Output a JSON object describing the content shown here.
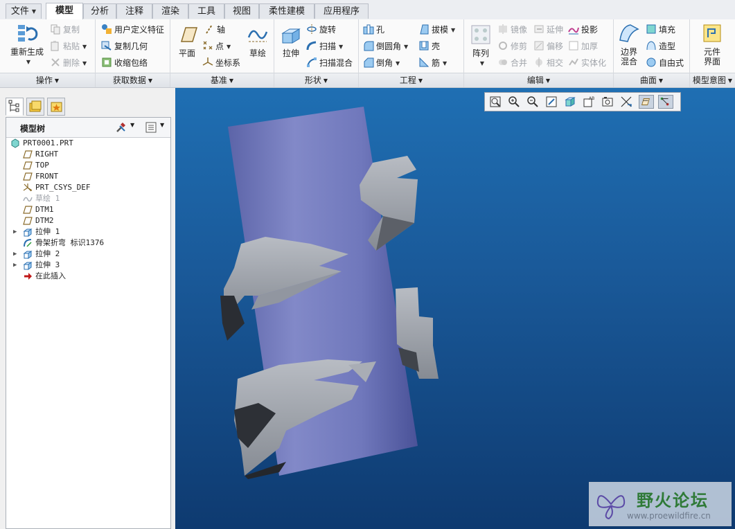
{
  "tabs": [
    {
      "label": "文件",
      "has_dropdown": true
    },
    {
      "label": "模型",
      "active": true
    },
    {
      "label": "分析"
    },
    {
      "label": "注释"
    },
    {
      "label": "渲染"
    },
    {
      "label": "工具"
    },
    {
      "label": "视图"
    },
    {
      "label": "柔性建模"
    },
    {
      "label": "应用程序"
    }
  ],
  "ribbon": {
    "operations": {
      "label": "操作",
      "regenerate": "重新生成",
      "copy": "复制",
      "paste": "粘贴",
      "delete": "删除"
    },
    "get_data": {
      "label": "获取数据",
      "udf": "用户定义特征",
      "copy_geometry": "复制几何",
      "shrinkwrap": "收缩包络"
    },
    "datum": {
      "label": "基准",
      "plane": "平面",
      "axis": "轴",
      "point": "点",
      "csys": "坐标系",
      "sketch": "草绘"
    },
    "shapes": {
      "label": "形状",
      "extrude": "拉伸",
      "revolve": "旋转",
      "sweep": "扫描",
      "swept_blend": "扫描混合"
    },
    "engineering": {
      "label": "工程",
      "hole": "孔",
      "round": "倒圆角",
      "chamfer": "倒角",
      "draft": "拔模",
      "shell": "壳",
      "rib": "筋"
    },
    "editing": {
      "label": "编辑",
      "pattern": "阵列",
      "mirror": "镜像",
      "trim": "修剪",
      "merge": "合并",
      "extend": "延伸",
      "offset": "偏移",
      "intersect": "相交",
      "project": "投影",
      "thicken": "加厚",
      "solidify": "实体化"
    },
    "surfaces": {
      "label": "曲面",
      "boundary_blend": "边界混合",
      "fill": "填充",
      "style": "造型",
      "freestyle": "自由式"
    },
    "model_intent": {
      "label": "模型意图",
      "component_interface": "元件界面"
    }
  },
  "model_tree": {
    "title": "模型树",
    "items": [
      {
        "label": "PRT0001.PRT",
        "icon": "part-icon",
        "level": 0
      },
      {
        "label": "RIGHT",
        "icon": "datum-plane-icon",
        "level": 1
      },
      {
        "label": "TOP",
        "icon": "datum-plane-icon",
        "level": 1
      },
      {
        "label": "FRONT",
        "icon": "datum-plane-icon",
        "level": 1
      },
      {
        "label": "PRT_CSYS_DEF",
        "icon": "csys-icon",
        "level": 1
      },
      {
        "label": "草绘 1",
        "icon": "sketch-icon",
        "level": 1,
        "dimmed": true
      },
      {
        "label": "DTM1",
        "icon": "datum-plane-icon",
        "level": 1
      },
      {
        "label": "DTM2",
        "icon": "datum-plane-icon",
        "level": 1
      },
      {
        "label": "拉伸 1",
        "icon": "extrude-icon",
        "level": 1,
        "expandable": true
      },
      {
        "label": "骨架折弯 标识1376",
        "icon": "spinal-bend-icon",
        "level": 1
      },
      {
        "label": "拉伸 2",
        "icon": "extrude-icon",
        "level": 1,
        "expandable": true
      },
      {
        "label": "拉伸 3",
        "icon": "extrude-icon",
        "level": 1,
        "expandable": true
      },
      {
        "label": "在此插入",
        "icon": "insert-here-icon",
        "level": 1
      }
    ]
  },
  "watermark": {
    "title": "野火论坛",
    "url": "www.proewildfire.cn"
  },
  "colors": {
    "viewport_top": "#1f6fb3",
    "viewport_bottom": "#0e3a70",
    "cylinder": "#7a83c4",
    "fins": "#9aa0a8"
  }
}
